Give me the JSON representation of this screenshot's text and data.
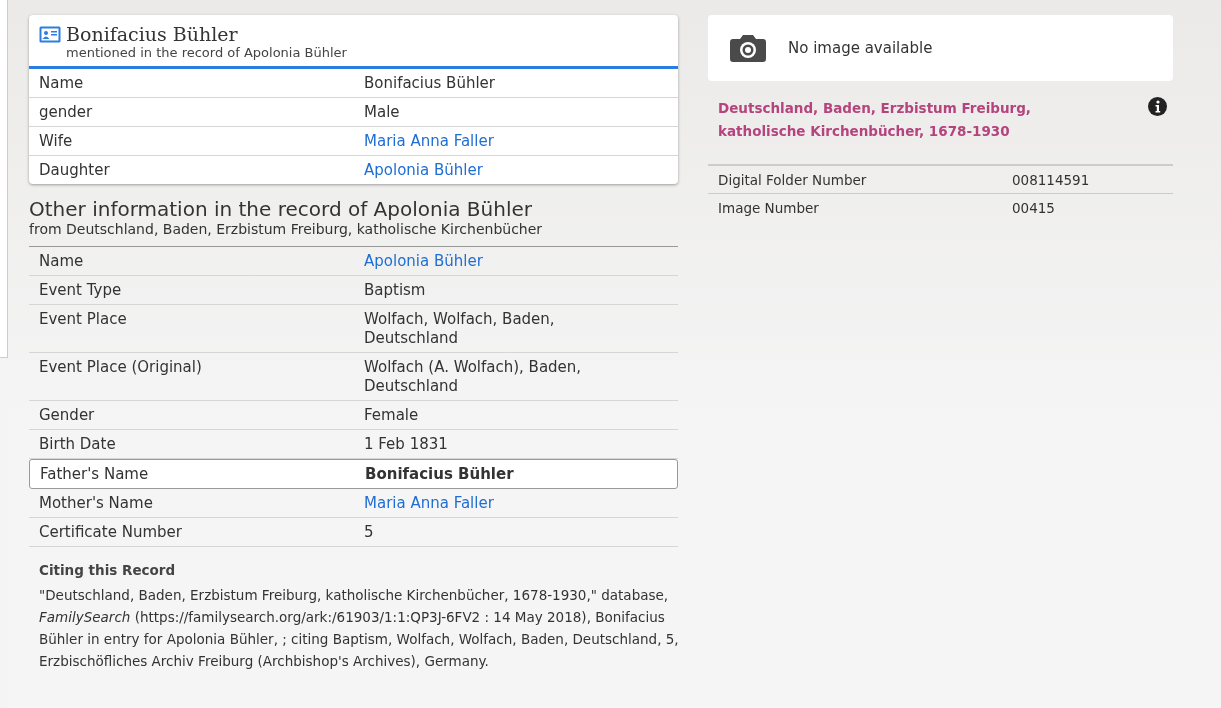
{
  "person_card": {
    "name": "Bonifacius Bühler",
    "subtitle": "mentioned in the record of Apolonia Bühler",
    "rows": [
      {
        "label": "Name",
        "value": "Bonifacius Bühler",
        "link": false
      },
      {
        "label": "gender",
        "value": "Male",
        "link": false
      },
      {
        "label": "Wife",
        "value": "Maria Anna Faller",
        "link": true
      },
      {
        "label": "Daughter",
        "value": "Apolonia Bühler",
        "link": true
      }
    ]
  },
  "other_info": {
    "title": "Other information in the record of Apolonia Bühler",
    "subtitle": "from Deutschland, Baden, Erzbistum Freiburg, katholische Kirchenbücher",
    "rows": [
      {
        "label": "Name",
        "value": "Apolonia Bühler",
        "link": true,
        "highlighted": false
      },
      {
        "label": "Event Type",
        "value": "Baptism",
        "link": false,
        "highlighted": false
      },
      {
        "label": "Event Place",
        "value": "Wolfach, Wolfach, Baden, Deutschland",
        "link": false,
        "highlighted": false
      },
      {
        "label": "Event Place (Original)",
        "value": "Wolfach (A. Wolfach), Baden, Deutschland",
        "link": false,
        "highlighted": false
      },
      {
        "label": "Gender",
        "value": "Female",
        "link": false,
        "highlighted": false
      },
      {
        "label": "Birth Date",
        "value": "1 Feb 1831",
        "link": false,
        "highlighted": false
      },
      {
        "label": "Father's Name",
        "value": "Bonifacius Bühler",
        "link": false,
        "highlighted": true
      },
      {
        "label": "Mother's Name",
        "value": "Maria Anna Faller",
        "link": true,
        "highlighted": false
      },
      {
        "label": "Certificate Number",
        "value": "5",
        "link": false,
        "highlighted": false
      }
    ]
  },
  "citation": {
    "heading": "Citing this Record",
    "text": "\"Deutschland, Baden, Erzbistum Freiburg, katholische Kirchenbücher, 1678-1930,\" database, *FamilySearch* (https://familysearch.org/ark:/61903/1:1:QP3J-6FV2 : 14 May 2018), Bonifacius Bühler in entry for Apolonia Bühler, ; citing Baptism, Wolfach, Wolfach, Baden, Deutschland, 5, Erzbischöfliches Archiv Freiburg (Archbishop's Archives), Germany."
  },
  "image_panel": {
    "message": "No image available",
    "collection": "Deutschland, Baden, Erzbistum Freiburg, katholische Kirchenbücher, 1678-1930",
    "rows": [
      {
        "label": "Digital Folder Number",
        "value": "008114591"
      },
      {
        "label": "Image Number",
        "value": "00415"
      }
    ]
  }
}
